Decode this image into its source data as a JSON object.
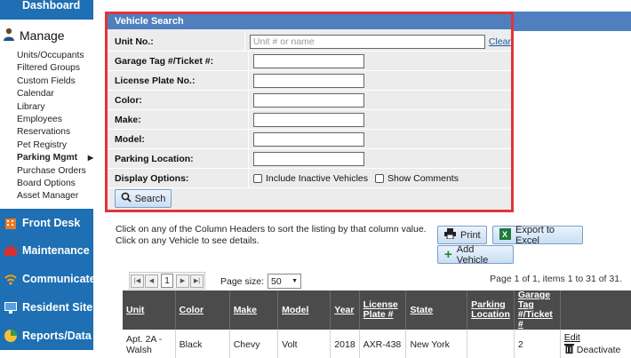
{
  "sidebar": {
    "dashboard": "Dashboard",
    "manage": "Manage",
    "items": [
      {
        "label": "Units/Occupants"
      },
      {
        "label": "Filtered Groups"
      },
      {
        "label": "Custom Fields"
      },
      {
        "label": "Calendar"
      },
      {
        "label": "Library"
      },
      {
        "label": "Employees"
      },
      {
        "label": "Reservations"
      },
      {
        "label": "Pet Registry"
      },
      {
        "label": "Parking Mgmt"
      },
      {
        "label": "Purchase Orders"
      },
      {
        "label": "Board Options"
      },
      {
        "label": "Asset Manager"
      }
    ],
    "sections": [
      {
        "label": "Front Desk",
        "icon": "building-icon"
      },
      {
        "label": "Maintenance",
        "icon": "toolbox-icon"
      },
      {
        "label": "Communicate",
        "icon": "wifi-icon"
      },
      {
        "label": "Resident Site",
        "icon": "monitor-icon"
      },
      {
        "label": "Reports/Data",
        "icon": "pie-chart-icon"
      }
    ]
  },
  "form": {
    "title": "Vehicle Search",
    "unit_label": "Unit No.:",
    "unit_placeholder": "Unit # or name",
    "clear": "Clear",
    "garage_label": "Garage Tag #/Ticket #:",
    "plate_label": "License Plate No.:",
    "color_label": "Color:",
    "make_label": "Make:",
    "model_label": "Model:",
    "location_label": "Parking Location:",
    "display_label": "Display Options:",
    "inactive_label": "Include Inactive Vehicles",
    "comments_label": "Show Comments",
    "search_button": "Search"
  },
  "info_text": "Click on any of the Column Headers to sort the listing by that column value. Click on any Vehicle to see details.",
  "actions": {
    "print": "Print",
    "export": "Export to Excel",
    "add": "Add Vehicle"
  },
  "pager": {
    "page": "1",
    "page_size_label": "Page size:",
    "page_size": "50",
    "info": "Page 1 of 1, items 1 to 31 of 31."
  },
  "table": {
    "headers": [
      "Unit",
      "Color",
      "Make",
      "Model",
      "Year",
      "License Plate #",
      "State",
      "Parking Location",
      "Garage Tag #/Ticket #",
      ""
    ],
    "rows": [
      {
        "unit": "Apt. 2A - Walsh",
        "color": "Black",
        "make": "Chevy",
        "model": "Volt",
        "year": "2018",
        "plate": "AXR-438",
        "state": "New York",
        "location": "",
        "tag": "2",
        "edit": "Edit",
        "deactivate": "Deactivate"
      }
    ]
  },
  "colors": {
    "nav_blue": "#1e6fb3",
    "panel_header": "#4f7fbd",
    "highlight_border": "#e0353b",
    "table_header": "#4b4b4b"
  }
}
